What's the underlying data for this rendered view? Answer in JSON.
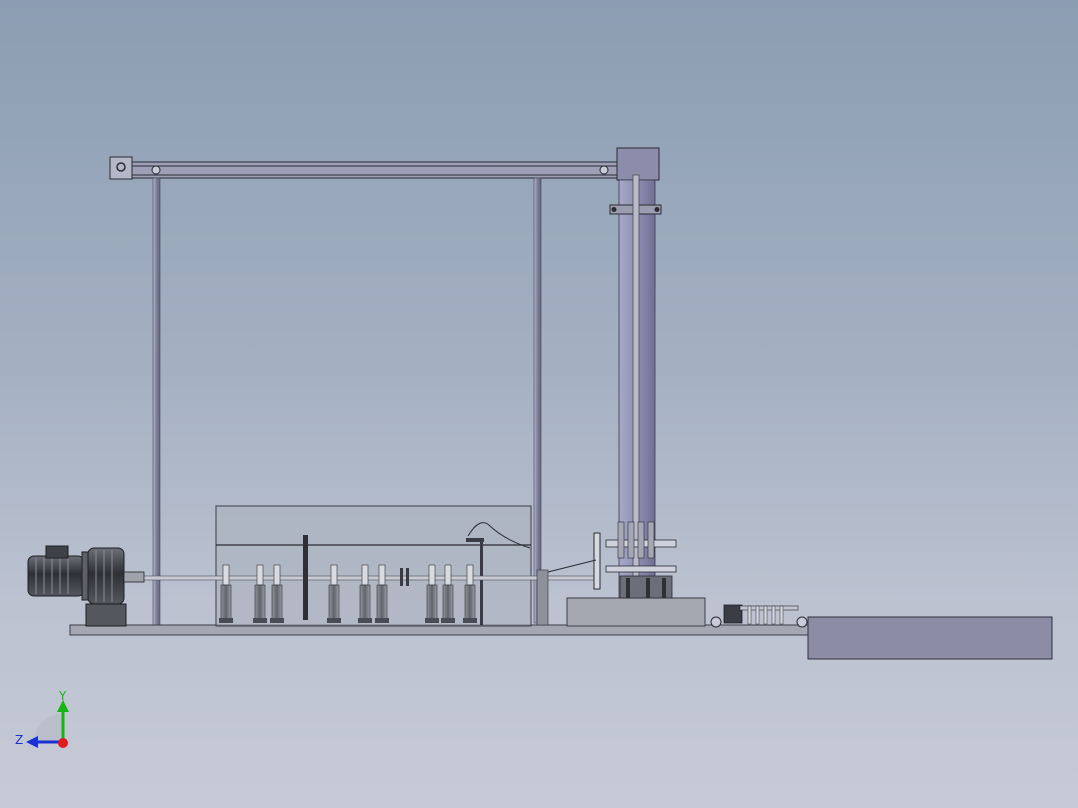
{
  "viewport": {
    "background_top": "#8b9db2",
    "background_bottom": "#c6cad6"
  },
  "triad": {
    "x_axis_label": "",
    "y_axis_label": "Y",
    "z_axis_label": "Z",
    "x_color": "#e01b1b",
    "y_color": "#16b516",
    "z_color": "#1a2fd6"
  },
  "model": {
    "steel_color": "#70757f",
    "frame_color": "#878aa3",
    "column_color": "#8e8fb2",
    "tank_fill": "#aab1bb",
    "block_color": "#8c8da4"
  }
}
